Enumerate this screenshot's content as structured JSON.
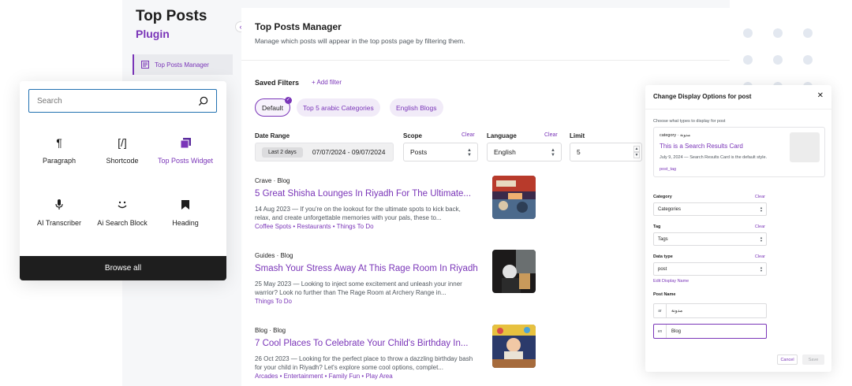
{
  "sidebar": {
    "title": "Top Posts",
    "subtitle": "Plugin",
    "items": [
      {
        "label": "Top Posts Manager"
      }
    ]
  },
  "main": {
    "title": "Top Posts Manager",
    "description": "Manage which posts will appear in the top posts page by filtering them.",
    "saved_filters_label": "Saved Filters",
    "add_filter_label": "+ Add filter",
    "filters": [
      {
        "label": "Default",
        "active": true
      },
      {
        "label": "Top 5 arabic Categories",
        "active": false
      },
      {
        "label": "English Blogs",
        "active": false
      }
    ],
    "date_range": {
      "label": "Date Range",
      "preset": "Last 2 days",
      "value": "07/07/2024 - 09/07/2024"
    },
    "scope": {
      "label": "Scope",
      "clear": "Clear",
      "value": "Posts"
    },
    "language": {
      "label": "Language",
      "clear": "Clear",
      "value": "English"
    },
    "limit": {
      "label": "Limit",
      "value": "5"
    },
    "posts": [
      {
        "categories": "Crave · Blog",
        "title": "5 Great Shisha Lounges In Riyadh For The Ultimate...",
        "excerpt": "14 Aug 2023 — If you're on the lookout for the ultimate spots to kick back, relax, and create unforgettable memories with your pals, these to...",
        "tags": "Coffee Spots • Restaurants • Things To Do"
      },
      {
        "categories": "Guides · Blog",
        "title": "Smash Your Stress Away At This Rage Room In Riyadh",
        "excerpt": "25 May 2023 — Looking to inject some excitement and unleash your inner warrior? Look no further than The Rage Room at Archery Range in...",
        "tags": "Things To Do"
      },
      {
        "categories": "Blog · Blog",
        "title": "7 Cool Places To Celebrate Your Child's Birthday In...",
        "excerpt": "26 Oct 2023 — Looking for the perfect place to throw a dazzling birthday bash for your child in Riyadh? Let's explore some cool options, complet...",
        "tags": "Arcades • Entertainment • Family Fun • Play Area"
      }
    ]
  },
  "inserter": {
    "search_placeholder": "Search",
    "blocks": [
      {
        "label": "Paragraph",
        "icon": "paragraph-icon"
      },
      {
        "label": "Shortcode",
        "icon": "shortcode-icon"
      },
      {
        "label": "Top Posts Widget",
        "icon": "widget-icon"
      },
      {
        "label": "AI Transcriber",
        "icon": "microphone-icon"
      },
      {
        "label": "Ai Search Block",
        "icon": "smiley-icon"
      },
      {
        "label": "Heading",
        "icon": "bookmark-icon"
      }
    ],
    "browse_all": "Browse all"
  },
  "modal": {
    "title": "Change Display Options for post",
    "hint": "Choose what types to display for post",
    "preview": {
      "category": "category · مدونة",
      "title": "This is a Search Results Card",
      "meta": "July 9, 2024 — Search Results Card is the default style.",
      "tag": "post_tag"
    },
    "category": {
      "label": "Category",
      "clear": "Clear",
      "value": "Categories"
    },
    "tag": {
      "label": "Tag",
      "clear": "Clear",
      "value": "Tags"
    },
    "data_type": {
      "label": "Data type",
      "clear": "Clear",
      "value": "post"
    },
    "edit_display_name": "Edit Display Name",
    "post_name": {
      "label": "Post Name",
      "ar_code": "ar",
      "ar_value": "مدونة",
      "en_code": "en",
      "en_value": "Blog"
    },
    "cancel": "Cancel",
    "save": "Save"
  },
  "colors": {
    "accent": "#7a35b8",
    "focus": "#2271b1",
    "dark": "#1e1e1e"
  }
}
